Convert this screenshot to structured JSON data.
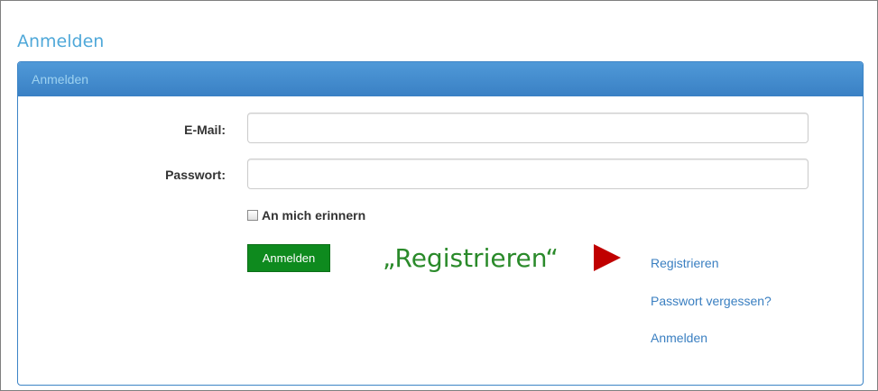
{
  "page": {
    "title": "Anmelden"
  },
  "panel": {
    "heading": "Anmelden"
  },
  "form": {
    "email_label": "E-Mail:",
    "email_value": "",
    "password_label": "Passwort:",
    "password_value": "",
    "remember_label": "An mich erinnern",
    "remember_checked": false,
    "submit_label": "Anmelden"
  },
  "annotation": {
    "text": "„Registrieren“",
    "arrow_icon": "arrow-right-icon",
    "text_color": "#2a8a2a",
    "arrow_color": "#c00000"
  },
  "links": {
    "register": "Registrieren",
    "forgot_password": "Passwort vergessen?",
    "login": "Anmelden"
  },
  "colors": {
    "title": "#4fa8d9",
    "panel_heading_bg": "#3a80c4",
    "button_bg": "#0e8a1e",
    "link": "#3a7fc1"
  }
}
